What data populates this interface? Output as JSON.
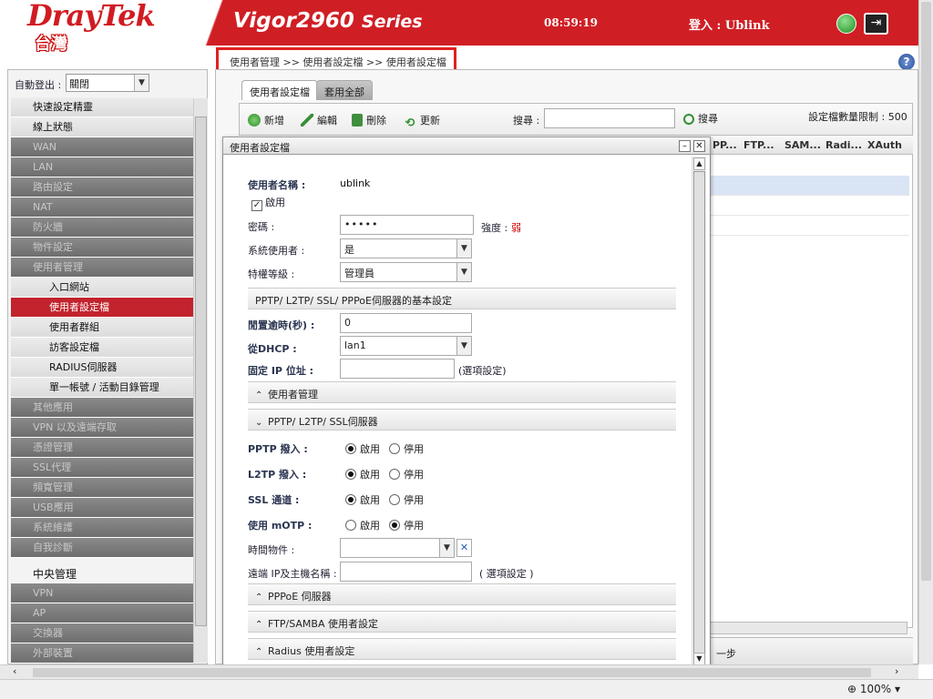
{
  "header": {
    "brand": "DrayTek",
    "product": "Vigor2960",
    "product_suffix": "Series",
    "clock": "08:59:19",
    "login": "登入 : Ublink",
    "region": "台灣",
    "bell_icon": "bell-icon",
    "logout_icon": "logout-icon"
  },
  "breadcrumb": "使用者管理 >> 使用者設定檔 >> 使用者設定檔",
  "sidebar": {
    "auto_logout_label": "自動登出 :",
    "auto_logout_value": "關閉",
    "items": [
      {
        "label": "快速設定精靈",
        "kind": "top"
      },
      {
        "label": "線上狀態",
        "kind": "top"
      },
      {
        "label": "WAN",
        "kind": "dark"
      },
      {
        "label": "LAN",
        "kind": "dark"
      },
      {
        "label": "路由設定",
        "kind": "dark"
      },
      {
        "label": "NAT",
        "kind": "dark"
      },
      {
        "label": "防火牆",
        "kind": "dark"
      },
      {
        "label": "物件設定",
        "kind": "dark"
      },
      {
        "label": "使用者管理",
        "kind": "dark"
      },
      {
        "label": "入口網站",
        "kind": "sub"
      },
      {
        "label": "使用者設定檔",
        "kind": "act"
      },
      {
        "label": "使用者群組",
        "kind": "sub"
      },
      {
        "label": "訪客設定檔",
        "kind": "sub"
      },
      {
        "label": "RADIUS伺服器",
        "kind": "sub"
      },
      {
        "label": "單一帳號 / 活動目錄管理",
        "kind": "sub"
      },
      {
        "label": "其他應用",
        "kind": "dark"
      },
      {
        "label": "VPN 以及遠端存取",
        "kind": "dark"
      },
      {
        "label": "憑證管理",
        "kind": "dark"
      },
      {
        "label": "SSL代理",
        "kind": "dark"
      },
      {
        "label": "頻寬管理",
        "kind": "dark"
      },
      {
        "label": "USB應用",
        "kind": "dark"
      },
      {
        "label": "系統維護",
        "kind": "dark"
      },
      {
        "label": "自我診斷",
        "kind": "dark"
      },
      {
        "label": "中央管理",
        "kind": "head"
      },
      {
        "label": "VPN",
        "kind": "dark"
      },
      {
        "label": "AP",
        "kind": "dark"
      },
      {
        "label": "交換器",
        "kind": "dark"
      },
      {
        "label": "外部裝置",
        "kind": "dark"
      }
    ]
  },
  "tabs": [
    "使用者設定檔",
    "套用全部"
  ],
  "toolbar": {
    "add": "新增",
    "edit": "編輯",
    "delete": "刪除",
    "refresh": "更新",
    "search_label": "搜尋 :",
    "search_button": "搜尋",
    "limit": "設定檔數量限制 : 500"
  },
  "grid": {
    "columns": [
      "PP...",
      "FTP...",
      "SAM...",
      "Radi...",
      "XAuth"
    ],
    "footer_text": "一步"
  },
  "dialog": {
    "title": "使用者設定檔",
    "username_label": "使用者名稱 :",
    "username_value": "ublink",
    "enable_label": "啟用",
    "password_label": "密碼 :",
    "password_value": "•••••",
    "strength_label": "強度 :",
    "strength_value": "弱",
    "sysuser_label": "系統使用者 :",
    "sysuser_value": "是",
    "privilege_label": "特權等級 :",
    "privilege_value": "管理員",
    "section_basic": "PPTP/ L2TP/ SSL/ PPPoE伺服器的基本設定",
    "idle_label": "閒置逾時(秒) :",
    "idle_value": "0",
    "dhcp_label": "從DHCP :",
    "dhcp_value": "lan1",
    "static_ip_label": "固定 IP 位址 :",
    "static_ip_value": "",
    "optional": "(選項設定)",
    "optional2": "( 選項設定 )",
    "section_usermgmt": "使用者管理",
    "section_pptp": "PPTP/ L2TP/ SSL伺服器",
    "pptp_label": "PPTP 撥入 :",
    "l2tp_label": "L2TP 撥入 :",
    "ssl_label": "SSL 通道 :",
    "motp_label": "使用 mOTP :",
    "opt_enable": "啟用",
    "opt_disable": "停用",
    "time_obj_label": "時間物件 :",
    "remote_ip_label": "遠端 IP及主機名稱 :",
    "section_pppoe": "PPPoE 伺服器",
    "section_ftp": "FTP/SAMBA 使用者設定",
    "section_radius": "Radius 使用者設定"
  },
  "status": {
    "zoom": "100%"
  },
  "colors": {
    "brand_red": "#cf1f25",
    "active_menu": "#c2232d",
    "highlight": "#e02020"
  }
}
